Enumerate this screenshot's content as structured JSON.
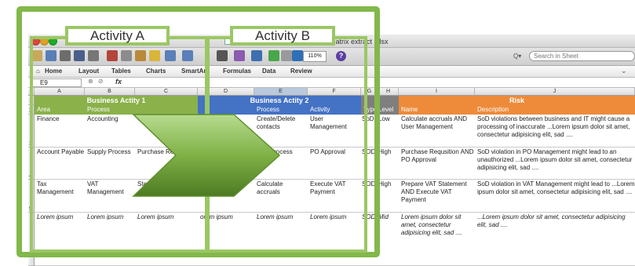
{
  "window": {
    "title": "Customer XYZ – Sample SoD matrix extract .xlsx"
  },
  "toolbar": {
    "zoom": "110%",
    "help": "?",
    "search_placeholder": "Search in Sheet"
  },
  "ribbon": {
    "tabs": [
      "Home",
      "Layout",
      "Tables",
      "Charts",
      "SmartArt",
      "Formulas",
      "Data",
      "Review"
    ]
  },
  "formula_bar": {
    "name_box": "E9",
    "fx": "fx"
  },
  "columns": [
    "A",
    "B",
    "C",
    "D",
    "E",
    "F",
    "G",
    "H",
    "I",
    "J"
  ],
  "row_numbers": [
    "1",
    "2",
    "3",
    "4",
    "5"
  ],
  "bands": {
    "activity1": "Business Actity 1",
    "activity2": "Business Actity 2",
    "risk": "Risk"
  },
  "headers": {
    "area": "Area",
    "process1": "Process",
    "activity1": "",
    "area2": "",
    "process2": "Process",
    "activity2": "Activity",
    "type": "Type",
    "level": "Level",
    "name": "Name",
    "description": "Description"
  },
  "rows": [
    {
      "area": "Finance",
      "process": "Accounting",
      "activity": "G",
      "area2": "",
      "process2": "Create/Delete contacts",
      "activity2": "User Management",
      "type": "SoD",
      "level": "Low",
      "name": "Calculate accruals AND User Management",
      "description": "SoD violations between business and IT might cause a processing of inaccurate ...Lorem ipsum dolor sit amet, consectetur adipisicing elit, sad ...."
    },
    {
      "area": "Account Payable",
      "process": "Supply Process",
      "activity": "Purchase Req",
      "area2": "",
      "process2": "pply Process",
      "activity2": "PO Approval",
      "type": "SOD",
      "level": "High",
      "name": "Purchase Requsition AND PO Approval",
      "description": "SoD violation in PO Management might lead to an unauthorized ...Lorem ipsum dolor sit amet, consectetur adipisicing elit, sad ...."
    },
    {
      "area": "Tax Management",
      "process": "VAT Management",
      "activity": "Statement",
      "area2": "anagement",
      "process2": "Calculate accruals",
      "activity2": "Execute VAT Payment",
      "type": "SOD",
      "level": "High",
      "name": "Prepare VAT Statement AND Execute VAT Payment",
      "description": "SoD violation in VAT Management might lead to ...Lorem ipsum dolor sit amet, consectetur adipisicing elit, sad ...."
    },
    {
      "area": "Lorem ipsum",
      "process": "Lorem ipsum",
      "activity": "Lorem ipsum",
      "area2": "orem ipsum",
      "process2": "Lorem ipsum",
      "activity2": "Lorem ipsum",
      "type": "SOD",
      "level": "Mid",
      "name": "Lorem ipsum dolor sit amet, consectetur adipisicing elit, sad ....",
      "description": "...Lorem ipsum dolor sit amet, consectetur adipisicing elit, sad ...."
    }
  ],
  "overlay": {
    "label_a": "Activity A",
    "label_b": "Activity B"
  },
  "colors": {
    "frame_green": "#82b84a",
    "activity1": "#8ab14a",
    "activity2": "#4472c4",
    "risk": "#ed8b3b"
  }
}
